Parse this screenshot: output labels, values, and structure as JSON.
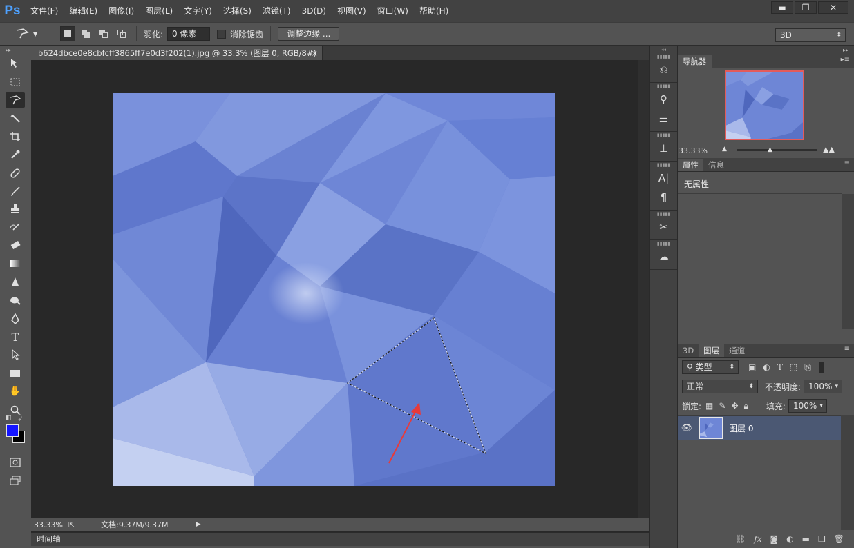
{
  "app": {
    "logo": "Ps",
    "menu": [
      "文件(F)",
      "编辑(E)",
      "图像(I)",
      "图层(L)",
      "文字(Y)",
      "选择(S)",
      "滤镜(T)",
      "3D(D)",
      "视图(V)",
      "窗口(W)",
      "帮助(H)"
    ],
    "window_buttons": {
      "minimize": "▬",
      "maximize": "❐",
      "close": "✕"
    }
  },
  "options": {
    "feather_label": "羽化:",
    "feather_value": "0 像素",
    "antialias_label": "消除锯齿",
    "refine_edge": "调整边缘 ...",
    "workspace": "3D"
  },
  "document": {
    "tab_title": "b624dbce0e8cbfcff3865ff7e0d3f202(1).jpg @ 33.3% (图层 0, RGB/8#) *",
    "tab_close": "×",
    "zoom": "33.33%",
    "doc_size": "文档:9.37M/9.37M"
  },
  "timeline_label": "时间轴",
  "panels": {
    "navigator": {
      "tab": "导航器",
      "zoom": "33.33%"
    },
    "properties": {
      "tabs": [
        "属性",
        "信息"
      ],
      "content": "无属性"
    },
    "layers": {
      "tabs": [
        "3D",
        "图层",
        "通道"
      ],
      "filter_kind": "类型",
      "blend_mode": "正常",
      "opacity_label": "不透明度:",
      "opacity_value": "100%",
      "lock_label": "锁定:",
      "fill_label": "填充:",
      "fill_value": "100%",
      "items": [
        {
          "name": "图层 0",
          "visible": true
        }
      ]
    }
  },
  "colors": {
    "foreground": "#1414ff",
    "background": "#000000",
    "selected_layer_bg": "#4b5873",
    "nav_frame": "#e35b5b",
    "arrow": "#e83a3a"
  }
}
